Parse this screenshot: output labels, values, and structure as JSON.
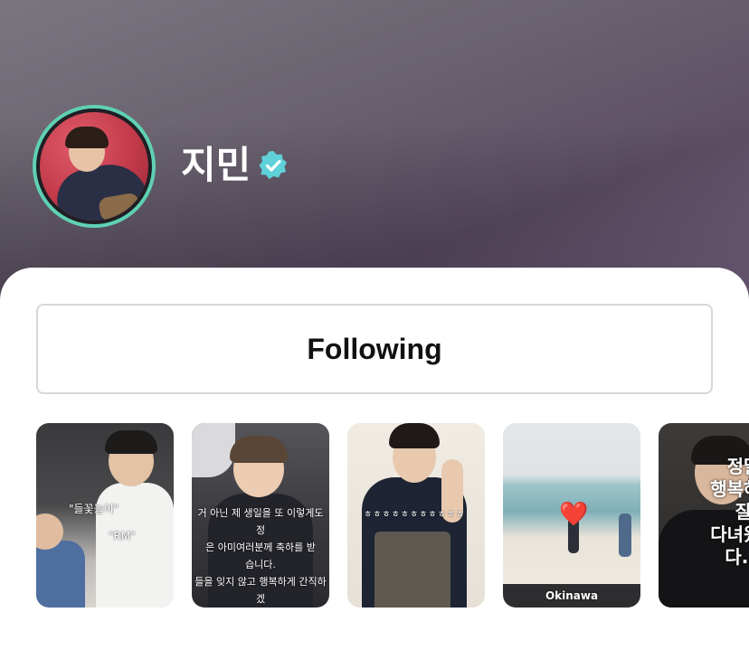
{
  "profile": {
    "name": "지민",
    "verified": true,
    "ring_color": "#5fd1b3",
    "verified_color": "#5fd1d9"
  },
  "follow_button": {
    "label": "Following"
  },
  "stories": [
    {
      "captions": [
        "\"들꽃놀이\"",
        "\"RM\""
      ]
    },
    {
      "captions": [
        "거 아닌 제 생일을 또 이렇게도 정\n은 아미여러분께 축하를 받\n습니다.\n들을 잊지 않고 행복하게 간직하겠\n니다.\n사랑합니다."
      ]
    },
    {
      "captions": [
        "ㅎㅎㅎㅎㅎㅎㅎㅎㅎㅎㅎ"
      ]
    },
    {
      "captions": [
        "Okinawa"
      ],
      "sticker": "❤️"
    },
    {
      "captions": [
        "정말\n행복하지\n잘\n다녀왔습\n다..."
      ]
    }
  ]
}
